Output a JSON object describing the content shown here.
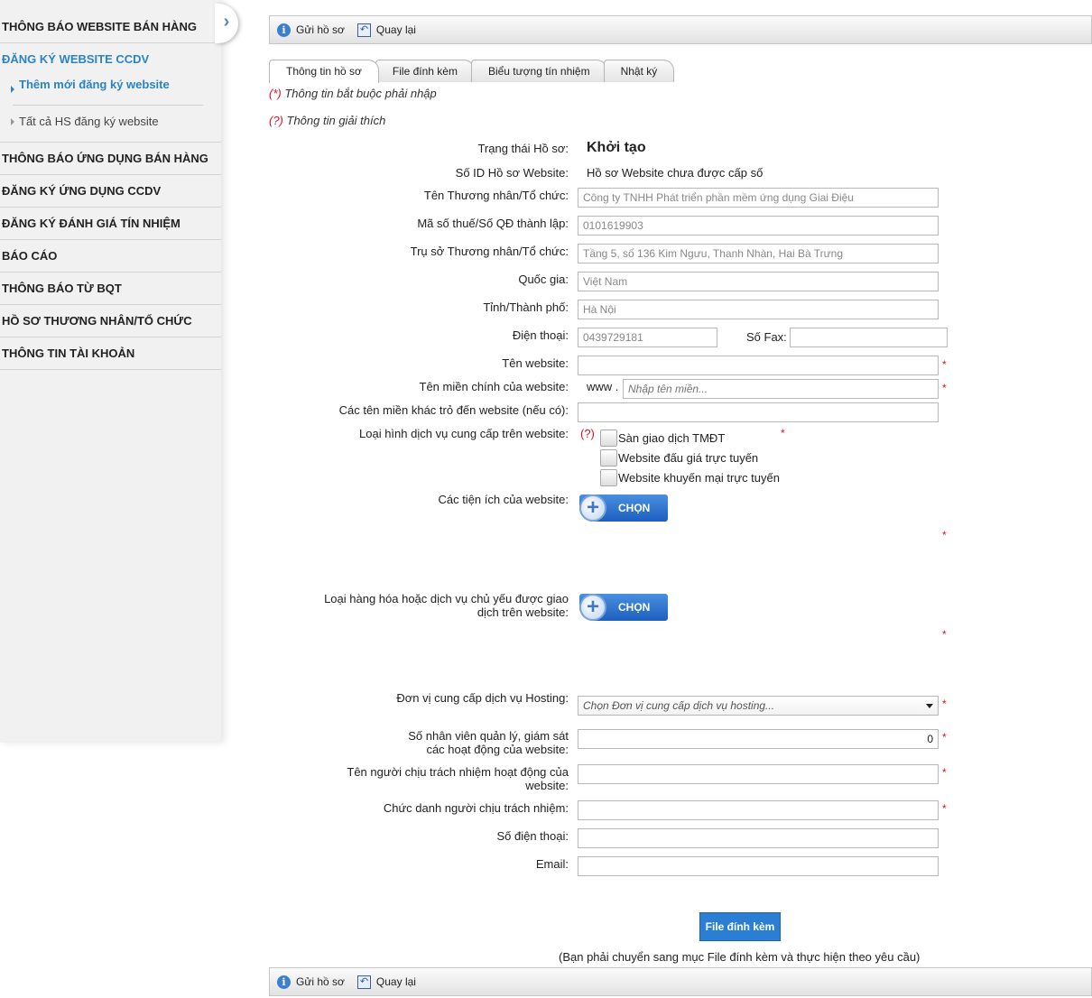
{
  "sidebar": {
    "collapse_icon": "chevron-right-icon",
    "items": [
      {
        "label": "THÔNG BÁO WEBSITE BÁN HÀNG"
      },
      {
        "label": "ĐĂNG KÝ WEBSITE CCDV"
      },
      {
        "label": "THÔNG BÁO ỨNG DỤNG BÁN HÀNG"
      },
      {
        "label": "ĐĂNG KÝ ỨNG DỤNG CCDV"
      },
      {
        "label": "ĐĂNG KÝ ĐÁNH GIÁ TÍN NHIỆM"
      },
      {
        "label": "BÁO CÁO"
      },
      {
        "label": "THÔNG BÁO TỪ BQT"
      },
      {
        "label": "HỒ SƠ THƯƠNG NHÂN/TỔ CHỨC"
      },
      {
        "label": "THÔNG TIN TÀI KHOẢN"
      }
    ],
    "subitems": [
      {
        "label": "Thêm mới đăng ký website"
      },
      {
        "label": "Tất cả HS đăng ký website"
      }
    ]
  },
  "toolbar": {
    "send_label": "Gửi hồ sơ",
    "back_label": "Quay lại"
  },
  "tabs": [
    {
      "label": "Thông tin hồ sơ"
    },
    {
      "label": "File đính kèm"
    },
    {
      "label": "Biểu tượng tín nhiệm"
    },
    {
      "label": "Nhật ký"
    }
  ],
  "notes": {
    "required_mark": "(*)",
    "required_text": "Thông tin bắt buộc phải nhập",
    "help_mark": "(?)",
    "help_text": "Thông tin giải thích"
  },
  "form": {
    "status_label": "Trạng thái Hồ sơ:",
    "status_value": "Khởi tạo",
    "id_label": "Số ID Hồ sơ Website:",
    "id_value": "Hồ sơ Website chưa được cấp số",
    "merchant_label": "Tên Thương nhân/Tổ chức:",
    "merchant_value": "Công ty TNHH Phát triển phần mềm ứng dụng Giai Điệu",
    "tax_label": "Mã số thuế/Số QĐ thành lập:",
    "tax_value": "0101619903",
    "address_label": "Trụ sở Thương nhân/Tổ chức:",
    "address_value": "Tầng 5, số 136 Kim Ngưu, Thanh Nhàn, Hai Bà Trưng",
    "country_label": "Quốc gia:",
    "country_value": "Việt Nam",
    "province_label": "Tỉnh/Thành phố:",
    "province_value": "Hà Nội",
    "phone_label": "Điện thoại:",
    "phone_value": "0439729181",
    "fax_label": "Số Fax:",
    "fax_value": "",
    "website_name_label": "Tên website:",
    "website_name_value": "",
    "domain_label": "Tên miền chính của website:",
    "domain_prefix": "www .",
    "domain_placeholder": "Nhập tên miền...",
    "other_domains_label": "Các tên miền khác trỏ đến website (nếu có):",
    "other_domains_value": "",
    "service_type_label": "Loại hình dịch vụ cung cấp trên website:",
    "service_help": "(?)",
    "service_options": [
      {
        "label": "Sàn giao dịch TMĐT",
        "checked": false
      },
      {
        "label": "Website đấu giá trực tuyến",
        "checked": false
      },
      {
        "label": "Website khuyến mại trực tuyến",
        "checked": false
      }
    ],
    "utilities_label": "Các tiện ích của website:",
    "goods_label_1": "Loại hàng hóa hoặc dịch vụ chủ yếu được giao",
    "goods_label_2": "dịch trên website:",
    "choose_label": "CHỌN",
    "hosting_label": "Đơn vị cung cấp dịch vụ Hosting:",
    "hosting_placeholder": "Chọn Đơn vị cung cấp dịch vụ hosting...",
    "staff_label_1": "Số nhân viên quản lý, giám sát",
    "staff_label_2": "các hoạt động của website:",
    "staff_value": "0",
    "responsible_label_1": "Tên người chịu trách nhiệm hoạt động của",
    "responsible_label_2": "website:",
    "responsible_value": "",
    "title_label": "Chức danh người chịu trách nhiệm:",
    "title_value": "",
    "contact_phone_label": "Số điện thoại:",
    "contact_phone_value": "",
    "email_label": "Email:",
    "email_value": "",
    "required_mark": "*"
  },
  "file_button_label": "File đính kèm",
  "file_hint": "(Bạn phải chuyển sang mục File đính kèm và thực hiện theo yêu cầu)"
}
